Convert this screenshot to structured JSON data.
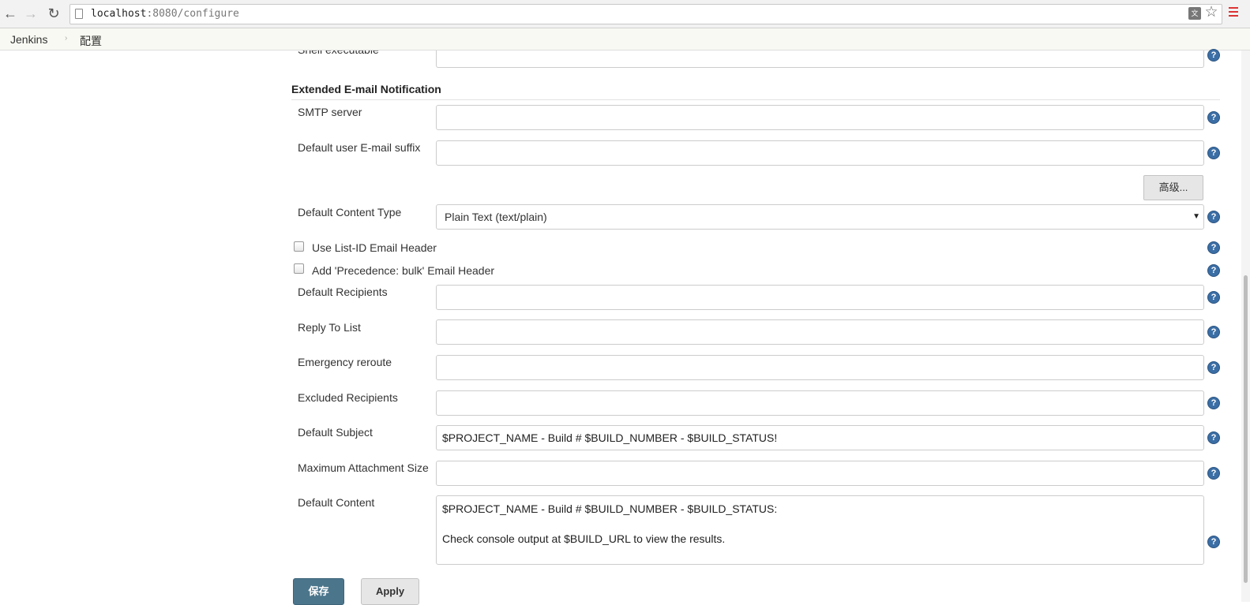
{
  "browser": {
    "url_host": "localhost",
    "url_rest": ":8080/configure",
    "back_glyph": "←",
    "forward_glyph": "→",
    "reload_glyph": "↻",
    "star_glyph": "☆",
    "translate_glyph": "文"
  },
  "breadcrumb": {
    "items": [
      "Jenkins",
      "配置"
    ],
    "separator": "›"
  },
  "form": {
    "partial_label": "Shell executable",
    "section_title": "Extended E-mail Notification",
    "smtp_server": {
      "label": "SMTP server",
      "value": ""
    },
    "email_suffix": {
      "label": "Default user E-mail suffix",
      "value": ""
    },
    "advanced_button": "高级...",
    "content_type": {
      "label": "Default Content Type",
      "value": "Plain Text (text/plain)"
    },
    "list_id_checkbox": {
      "label": "Use List-ID Email Header",
      "checked": false
    },
    "precedence_checkbox": {
      "label": "Add 'Precedence: bulk' Email Header",
      "checked": false
    },
    "default_recipients": {
      "label": "Default Recipients",
      "value": ""
    },
    "reply_to": {
      "label": "Reply To List",
      "value": ""
    },
    "emergency_reroute": {
      "label": "Emergency reroute",
      "value": ""
    },
    "excluded_recipients": {
      "label": "Excluded Recipients",
      "value": ""
    },
    "default_subject": {
      "label": "Default Subject",
      "value": "$PROJECT_NAME - Build # $BUILD_NUMBER - $BUILD_STATUS!"
    },
    "max_attachment": {
      "label": "Maximum Attachment Size",
      "value": ""
    },
    "default_content": {
      "label": "Default Content",
      "lines": [
        "$PROJECT_NAME - Build # $BUILD_NUMBER - $BUILD_STATUS:",
        "",
        "Check console output at $BUILD_URL to view the results."
      ]
    },
    "help_glyph": "?"
  },
  "actions": {
    "save": "保存",
    "apply": "Apply"
  },
  "colors": {
    "help": "#3b6ea5",
    "save": "#4b758b",
    "breadcrumb_bg": "#f9f9f3"
  }
}
